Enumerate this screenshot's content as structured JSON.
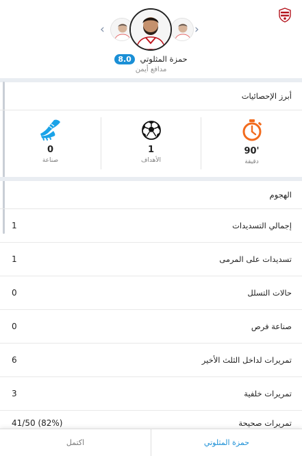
{
  "header": {
    "player_name": "حمزة المثلوتي",
    "rating": "8.0",
    "position": "مدافع أيمن"
  },
  "highlights": {
    "title": "أبرز الإحصائيات",
    "items": [
      {
        "value": "90'",
        "label": "دقيقة",
        "icon": "stopwatch-icon",
        "color": "#f26b1d"
      },
      {
        "value": "1",
        "label": "الأهداف",
        "icon": "football-icon",
        "color": "#111111"
      },
      {
        "value": "0",
        "label": "صناعة",
        "icon": "football-boot-icon",
        "color": "#1aa3e8"
      }
    ]
  },
  "attack": {
    "title": "الهجوم",
    "rows": [
      {
        "label": "إجمالي التسديدات",
        "value": "1"
      },
      {
        "label": "تسديدات على المرمى",
        "value": "1"
      },
      {
        "label": "حالات التسلل",
        "value": "0"
      },
      {
        "label": "صناعة فرص",
        "value": "0"
      },
      {
        "label": "تمريرات لداخل الثلث الأخير",
        "value": "6"
      },
      {
        "label": "تمريرات خلفية",
        "value": "3"
      },
      {
        "label": "تمريرات صحيحة",
        "value": "41/50 (82%)"
      }
    ]
  },
  "bottom_tabs": {
    "full_label": "اكتمل",
    "player_label": "حمزة المثلوتي"
  },
  "colors": {
    "accent": "#1a8fd6",
    "section_gap": "#e9edf2"
  }
}
